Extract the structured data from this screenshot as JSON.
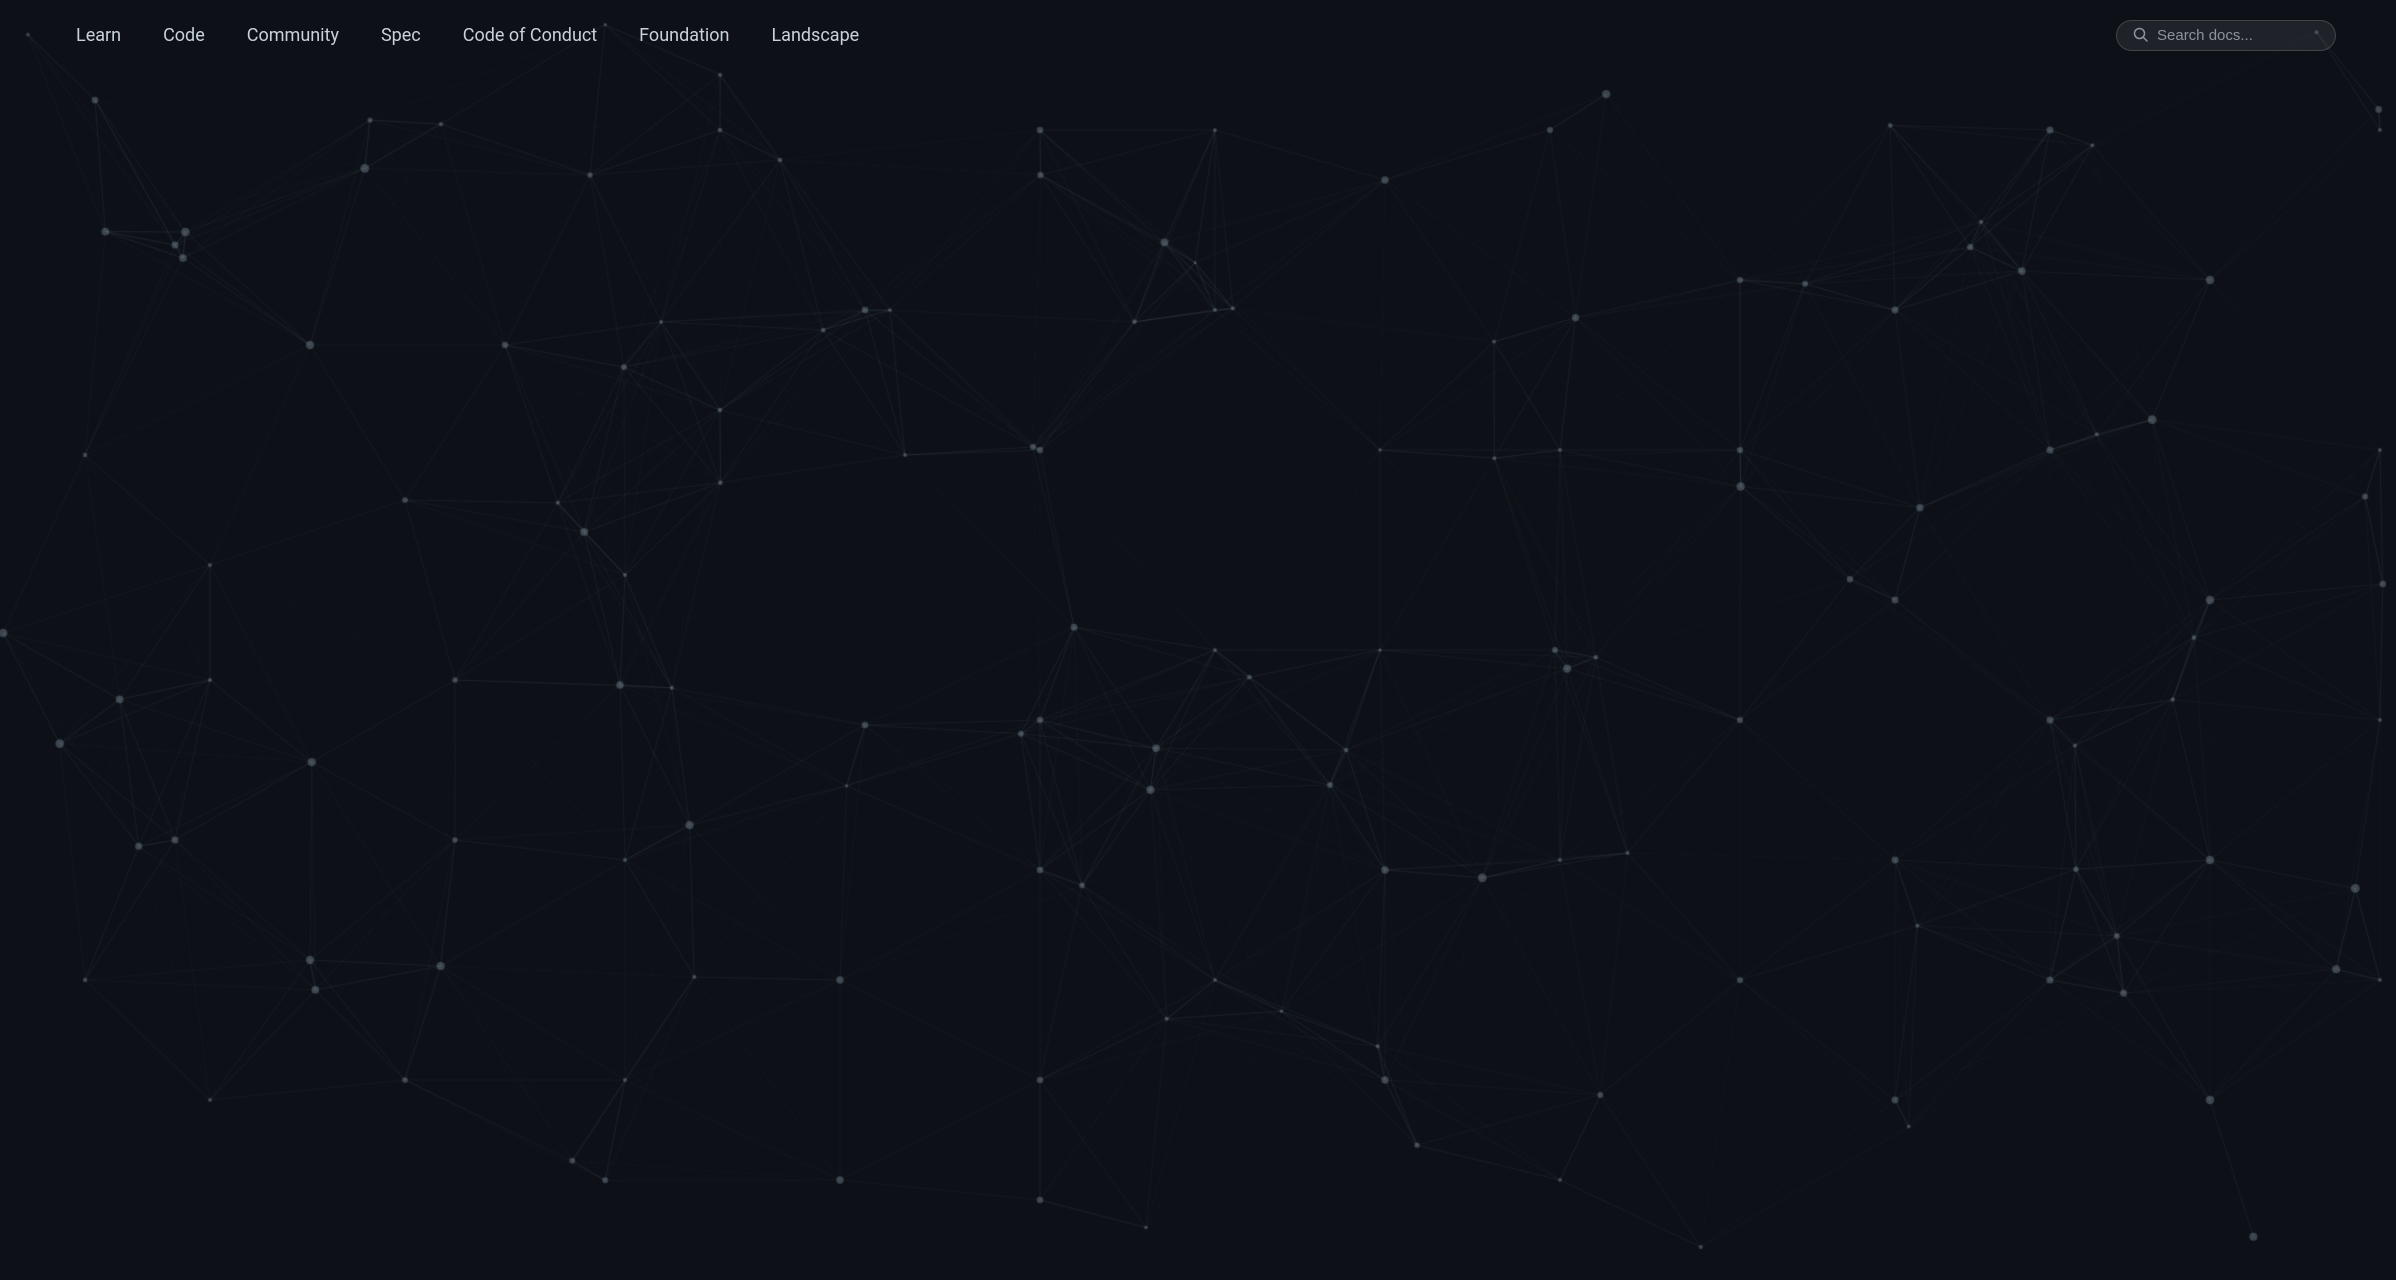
{
  "nav": {
    "links": [
      {
        "id": "learn",
        "label": "Learn"
      },
      {
        "id": "code",
        "label": "Code"
      },
      {
        "id": "community",
        "label": "Community"
      },
      {
        "id": "spec",
        "label": "Spec"
      },
      {
        "id": "code-of-conduct",
        "label": "Code of Conduct"
      },
      {
        "id": "foundation",
        "label": "Foundation"
      },
      {
        "id": "landscape",
        "label": "Landscape"
      }
    ],
    "search": {
      "placeholder": "Search docs...",
      "value": ""
    }
  },
  "background": {
    "node_color": "rgba(255,255,255,0.18)",
    "line_color": "rgba(255,255,255,0.07)",
    "bg_color": "#0d1117"
  }
}
